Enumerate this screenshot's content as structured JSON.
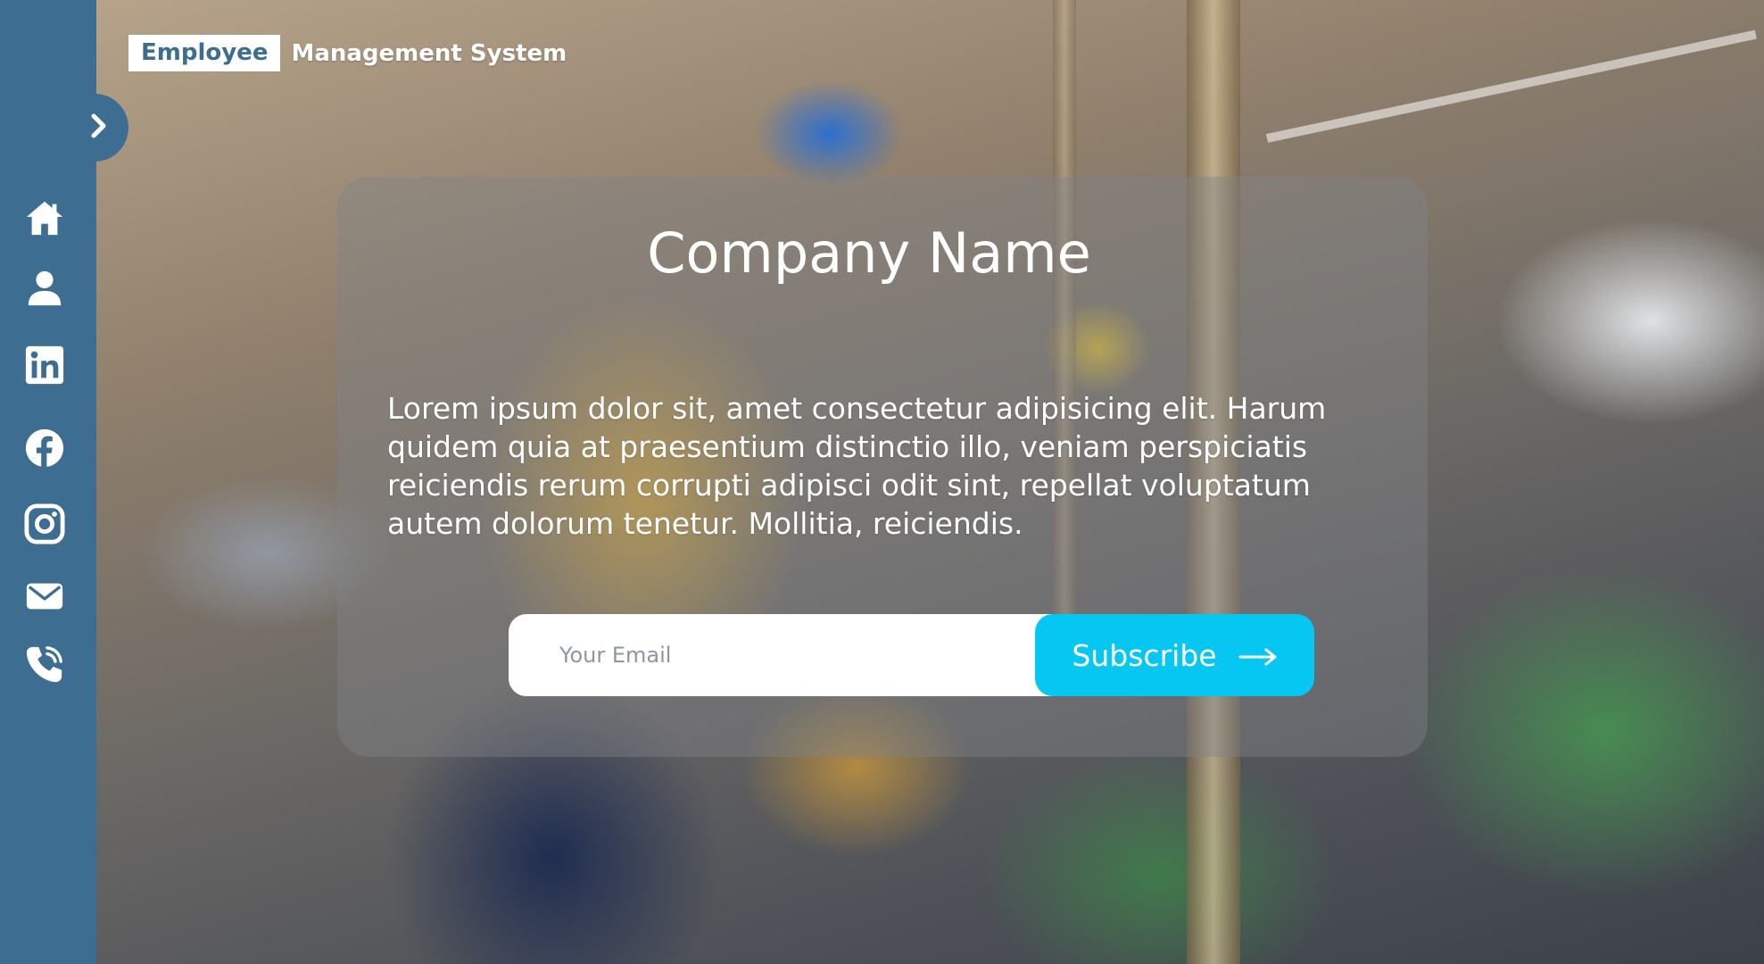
{
  "header": {
    "brand_highlight": "Employee",
    "brand_rest": "Management System"
  },
  "sidebar": {
    "toggle_icon": "chevron-right-icon",
    "items": [
      {
        "icon": "home-icon"
      },
      {
        "icon": "user-icon"
      },
      {
        "icon": "linkedin-icon"
      },
      {
        "icon": "facebook-icon"
      },
      {
        "icon": "instagram-icon"
      },
      {
        "icon": "mail-icon"
      },
      {
        "icon": "phone-icon"
      }
    ]
  },
  "hero": {
    "company_name": "Company Name",
    "description": "Lorem ipsum dolor sit, amet consectetur adipisicing elit. Harum quidem quia at praesentium distinctio illo, veniam perspiciatis reiciendis rerum corrupti adipisci odit sint, repellat voluptatum autem dolorum tenetur. Mollitia, reiciendis.",
    "email_placeholder": "Your Email",
    "subscribe_label": "Subscribe",
    "subscribe_icon": "arrow-right-icon"
  },
  "colors": {
    "sidebar": "#3d6e91",
    "accent": "#05c7f2",
    "card": "rgba(128,130,135,0.42)"
  }
}
